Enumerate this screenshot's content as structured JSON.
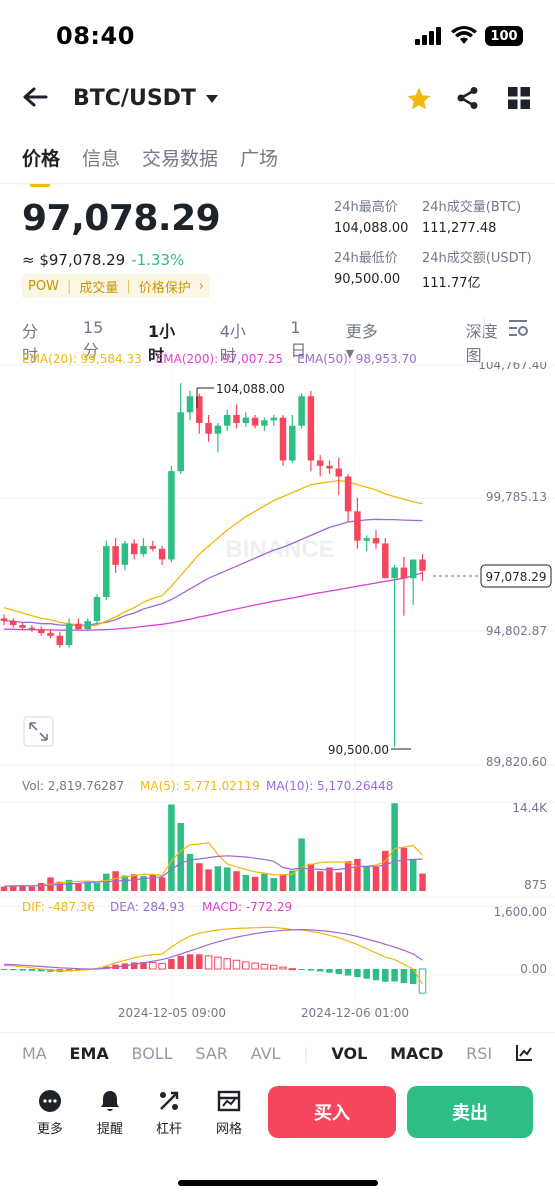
{
  "status": {
    "time": "08:40",
    "battery": "100"
  },
  "header": {
    "pair": "BTC/USDT"
  },
  "tabs": [
    "价格",
    "信息",
    "交易数据",
    "广场"
  ],
  "ticker": {
    "price": "97,078.29",
    "fiat": "≈ $97,078.29",
    "change": "-1.33%",
    "tags": [
      "POW",
      "成交量",
      "价格保护"
    ],
    "high_label": "24h最高价",
    "high": "104,088.00",
    "low_label": "24h最低价",
    "low": "90,500.00",
    "vol_btc_label": "24h成交量(BTC)",
    "vol_btc": "111,277.48",
    "vol_usdt_label": "24h成交额(USDT)",
    "vol_usdt": "111.77亿"
  },
  "intervals": [
    "分时",
    "15分",
    "1小时",
    "4小时",
    "1日",
    "更多",
    "深度图"
  ],
  "ema": {
    "ema20": "EMA(20): 99,584.33",
    "ema200": "EMA(200): 97,007.25",
    "ema50": "EMA(50): 98,953.70"
  },
  "vol_legend": {
    "vol": "Vol: 2,819.76287",
    "ma5": "MA(5): 5,771.02119",
    "ma10": "MA(10): 5,170.26448"
  },
  "macd_legend": {
    "dif": "DIF: -487.36",
    "dea": "DEA: 284.93",
    "macd": "MACD: -772.29"
  },
  "chart_labels": {
    "y_top": "104,767.40",
    "y2": "99,785.13",
    "y3": "94,802.87",
    "y_bot": "89,820.60",
    "current": "97,078.29",
    "high_mark": "104,088.00",
    "low_mark": "90,500.00",
    "vol_top": "14.4K",
    "vol_bot": "875",
    "macd_top": "1,600.00",
    "macd_zero": "0.00",
    "time1": "2024-12-05 09:00",
    "time2": "2024-12-06 01:00",
    "watermark": "BINANCE"
  },
  "indicators": [
    "MA",
    "EMA",
    "BOLL",
    "SAR",
    "AVL",
    "VOL",
    "MACD",
    "RSI"
  ],
  "actions": [
    "更多",
    "提醒",
    "杠杆",
    "网格"
  ],
  "buy": "买入",
  "sell": "卖出",
  "colors": {
    "up": "#2ebd85",
    "down": "#f6465d",
    "accent": "#f0b90b",
    "ema20": "#f0b90b",
    "ema50": "#9c6ad6",
    "ema200": "#e040d0"
  },
  "chart_data": {
    "type": "candlestick",
    "ylim": [
      89820.6,
      104767.4
    ],
    "candles": [
      [
        95300,
        95450,
        95050,
        95200
      ],
      [
        95200,
        95300,
        94950,
        95050
      ],
      [
        95050,
        95150,
        94850,
        94950
      ],
      [
        94950,
        95050,
        94800,
        94900
      ],
      [
        94900,
        95000,
        94650,
        94750
      ],
      [
        94750,
        94900,
        94550,
        94650
      ],
      [
        94650,
        94800,
        94200,
        94300
      ],
      [
        94300,
        95300,
        94200,
        95100
      ],
      [
        95100,
        95300,
        94850,
        94900
      ],
      [
        94900,
        95300,
        94850,
        95200
      ],
      [
        95200,
        96200,
        95100,
        96100
      ],
      [
        96100,
        98200,
        96000,
        98000
      ],
      [
        98000,
        98300,
        97000,
        97300
      ],
      [
        97300,
        98200,
        97100,
        98100
      ],
      [
        98100,
        98250,
        97500,
        97700
      ],
      [
        97700,
        98300,
        97600,
        98000
      ],
      [
        98000,
        98200,
        97800,
        97900
      ],
      [
        97900,
        98000,
        97300,
        97500
      ],
      [
        97500,
        101000,
        97400,
        100800
      ],
      [
        100800,
        104088,
        100700,
        103000
      ],
      [
        103000,
        103800,
        102700,
        103600
      ],
      [
        103600,
        103700,
        102200,
        102600
      ],
      [
        102600,
        102900,
        101900,
        102200
      ],
      [
        102200,
        102600,
        101500,
        102500
      ],
      [
        102500,
        103100,
        102300,
        102900
      ],
      [
        102900,
        103300,
        102400,
        102600
      ],
      [
        102600,
        103000,
        102450,
        102800
      ],
      [
        102800,
        102900,
        102400,
        102500
      ],
      [
        102500,
        102800,
        102300,
        102700
      ],
      [
        102700,
        102900,
        102500,
        102800
      ],
      [
        102800,
        102900,
        101000,
        101200
      ],
      [
        101200,
        102900,
        101100,
        102500
      ],
      [
        102500,
        103700,
        102400,
        103600
      ],
      [
        103600,
        103800,
        100800,
        101200
      ],
      [
        101200,
        101400,
        100600,
        101000
      ],
      [
        101000,
        101200,
        100700,
        100900
      ],
      [
        100900,
        101300,
        99900,
        100600
      ],
      [
        100600,
        100700,
        98900,
        99300
      ],
      [
        99300,
        99800,
        97900,
        98200
      ],
      [
        98200,
        98400,
        97800,
        98300
      ],
      [
        98300,
        98600,
        97900,
        98100
      ],
      [
        98100,
        98300,
        97200,
        96800
      ],
      [
        96800,
        97300,
        90500,
        97200
      ],
      [
        97200,
        97600,
        95400,
        96800
      ],
      [
        96800,
        97500,
        95800,
        97500
      ],
      [
        97500,
        97700,
        96700,
        97078
      ]
    ],
    "ema20": [
      95700,
      95600,
      95500,
      95400,
      95300,
      95250,
      95150,
      95100,
      95050,
      95000,
      95050,
      95200,
      95350,
      95550,
      95700,
      95900,
      96050,
      96150,
      96500,
      96900,
      97300,
      97700,
      98000,
      98300,
      98600,
      98850,
      99100,
      99300,
      99500,
      99700,
      99850,
      100000,
      100150,
      100300,
      100350,
      100400,
      100450,
      100400,
      100300,
      100200,
      100100,
      99950,
      99850,
      99750,
      99660,
      99584
    ],
    "ema50": [
      95200,
      95200,
      95150,
      95150,
      95100,
      95100,
      95050,
      95050,
      95050,
      95050,
      95100,
      95150,
      95250,
      95400,
      95500,
      95650,
      95750,
      95850,
      96000,
      96200,
      96400,
      96600,
      96800,
      96950,
      97100,
      97250,
      97400,
      97550,
      97700,
      97850,
      97950,
      98100,
      98250,
      98400,
      98550,
      98700,
      98800,
      98900,
      98950,
      98980,
      99000,
      98990,
      98990,
      98970,
      98960,
      98953
    ],
    "ema200": [
      94900,
      94890,
      94880,
      94880,
      94870,
      94870,
      94860,
      94860,
      94860,
      94860,
      94870,
      94880,
      94900,
      94930,
      94960,
      95000,
      95040,
      95080,
      95130,
      95200,
      95270,
      95350,
      95420,
      95500,
      95580,
      95650,
      95730,
      95800,
      95870,
      95940,
      96000,
      96060,
      96130,
      96200,
      96260,
      96320,
      96380,
      96440,
      96500,
      96560,
      96620,
      96680,
      96740,
      96800,
      96900,
      97007
    ],
    "volume": [
      700,
      900,
      800,
      700,
      1300,
      2200,
      1500,
      1800,
      1200,
      1600,
      1300,
      2800,
      3200,
      2500,
      2700,
      2400,
      2600,
      2200,
      14000,
      11000,
      6000,
      4500,
      3500,
      4000,
      3800,
      3200,
      2600,
      2300,
      2800,
      2100,
      2700,
      3300,
      8500,
      4400,
      3200,
      3800,
      3000,
      4800,
      5200,
      4000,
      3900,
      6500,
      14200,
      7000,
      5200,
      2820
    ],
    "ma5": [
      800,
      820,
      840,
      850,
      880,
      1100,
      1300,
      1500,
      1550,
      1600,
      1500,
      1700,
      2000,
      2300,
      2500,
      2700,
      2700,
      2500,
      4800,
      6500,
      7500,
      7600,
      7800,
      5900,
      4400,
      3900,
      3500,
      3100,
      2900,
      2600,
      2600,
      2700,
      3900,
      4300,
      4600,
      4700,
      4700,
      4600,
      4000,
      4000,
      4200,
      4800,
      6900,
      7100,
      7400,
      5771
    ],
    "ma10": [
      800,
      810,
      820,
      830,
      850,
      950,
      1050,
      1150,
      1250,
      1350,
      1450,
      1500,
      1600,
      1700,
      1800,
      2000,
      2150,
      2300,
      3500,
      4500,
      5000,
      5200,
      5400,
      5600,
      5700,
      5600,
      5500,
      5300,
      5100,
      4800,
      3800,
      3500,
      3700,
      3600,
      3500,
      3400,
      3500,
      3700,
      3900,
      4000,
      4000,
      4200,
      4800,
      5000,
      5100,
      5170
    ],
    "dif": [
      120,
      100,
      70,
      40,
      0,
      -30,
      -60,
      -50,
      -40,
      -20,
      20,
      100,
      200,
      280,
      360,
      420,
      460,
      480,
      700,
      900,
      1050,
      1150,
      1200,
      1250,
      1280,
      1300,
      1310,
      1320,
      1330,
      1330,
      1300,
      1260,
      1250,
      1200,
      1150,
      1080,
      1000,
      900,
      780,
      650,
      520,
      380,
      300,
      150,
      0,
      -487
    ],
    "dea": [
      150,
      140,
      120,
      100,
      80,
      60,
      40,
      25,
      10,
      0,
      0,
      20,
      60,
      100,
      150,
      200,
      250,
      300,
      380,
      480,
      580,
      680,
      780,
      870,
      950,
      1020,
      1080,
      1130,
      1180,
      1210,
      1240,
      1250,
      1260,
      1250,
      1230,
      1200,
      1160,
      1110,
      1040,
      960,
      880,
      790,
      700,
      600,
      480,
      285
    ]
  }
}
